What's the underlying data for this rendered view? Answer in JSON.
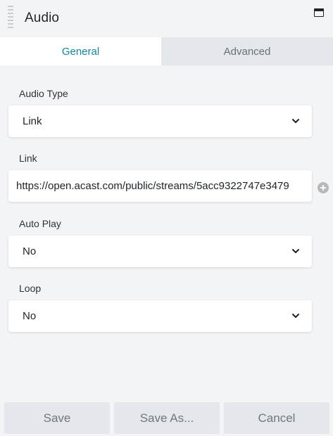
{
  "panel": {
    "title": "Audio"
  },
  "tabs": [
    {
      "label": "General",
      "active": true
    },
    {
      "label": "Advanced",
      "active": false
    }
  ],
  "fields": {
    "audio_type": {
      "label": "Audio Type",
      "value": "Link"
    },
    "link": {
      "label": "Link",
      "value": "https://open.acast.com/public/streams/5acc9322747e3479"
    },
    "auto_play": {
      "label": "Auto Play",
      "value": "No"
    },
    "loop": {
      "label": "Loop",
      "value": "No"
    }
  },
  "footer": {
    "save": "Save",
    "save_as": "Save As...",
    "cancel": "Cancel"
  },
  "colors": {
    "accent": "#0e8a9b",
    "background": "#f3f4f6",
    "inactive_tab": "#e4e7eb"
  },
  "icons": [
    "drag-handle-icon",
    "window-icon",
    "chevron-down-icon",
    "plus-circle-icon"
  ]
}
